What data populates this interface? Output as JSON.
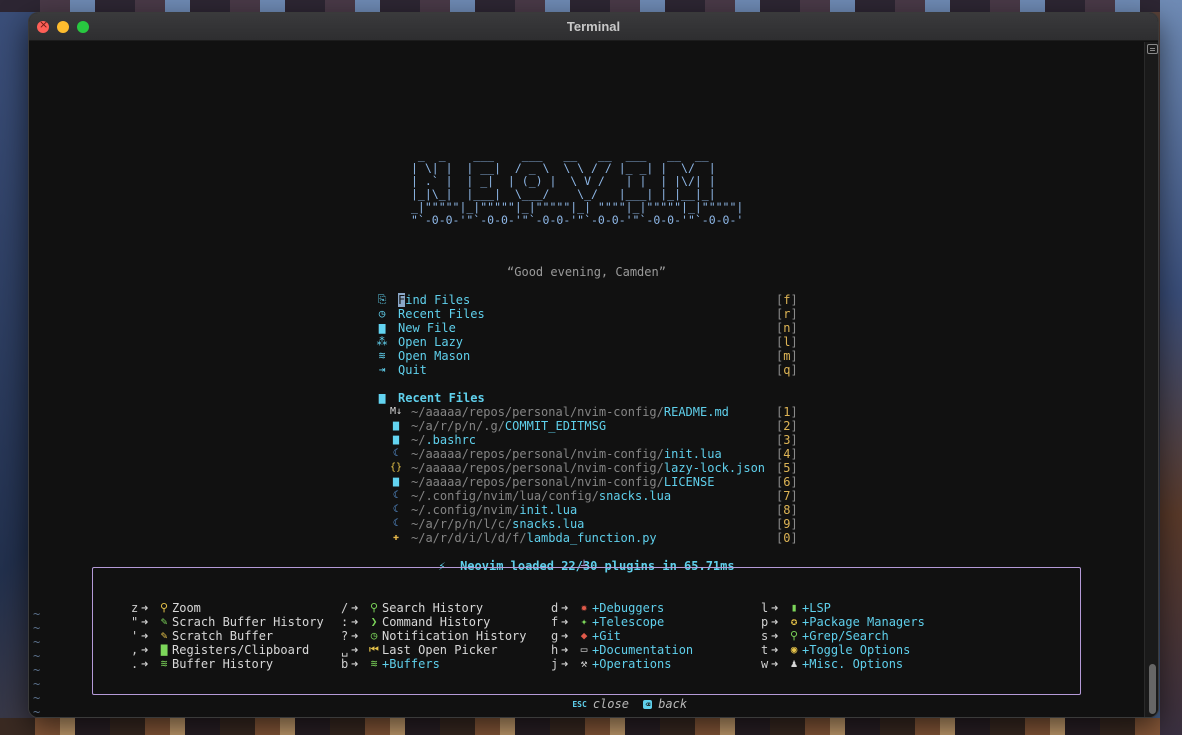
{
  "window": {
    "title": "Terminal"
  },
  "logo": " _  _    ___    ___   __   __  ___   __  __ \n| \\| |  | __|  / _ \\  \\ \\ / / |_ _| |  \\/  |\n| .` |  | _|  | (_) |  \\ V /   | |  | |\\/| |\n|_|\\_|  |___|  \\___/    \\_/   |___| |_|__|_|\n_|\"\"\"\"\"|_|\"\"\"\"\"|_|\"\"\"\"\"|_| \"\"\"\"|_|\"\"\"\"\"|_|\"\"\"\"\"| \n\"`-0-0-'\"`-0-0-'\"`-0-0-'\"`-0-0-'\"`-0-0-'\"`-0-0-'",
  "greeting": "“Good evening, Camden”",
  "menu": [
    {
      "icon": "⎘",
      "icon_name": "find-files-icon",
      "label_first": "F",
      "label_rest": "ind Files",
      "key": "f"
    },
    {
      "icon": "◷",
      "icon_name": "history-icon",
      "label": "Recent Files",
      "key": "r"
    },
    {
      "icon": "▆",
      "icon_name": "new-file-icon",
      "label": "New File",
      "key": "n"
    },
    {
      "icon": "⁂",
      "icon_name": "sleep-icon",
      "label": "Open Lazy",
      "key": "l"
    },
    {
      "icon": "≋",
      "icon_name": "mason-icon",
      "label": "Open Mason",
      "key": "m"
    },
    {
      "icon": "⇥",
      "icon_name": "quit-icon",
      "label": "Quit",
      "key": "q"
    }
  ],
  "recent_section": {
    "icon": "▆",
    "label": "Recent Files"
  },
  "recent_files": [
    {
      "icon": "M↓",
      "icon_name": "markdown-icon",
      "icon_color": "#d8d8d8",
      "dir": "~/aaaaa/repos/personal/nvim-config/",
      "name": "README.md",
      "key": "1"
    },
    {
      "icon": "▆",
      "icon_name": "file-icon",
      "icon_color": "#62d3f0",
      "dir": "~/a/r/p/n/.g/",
      "name": "COMMIT_EDITMSG",
      "key": "2"
    },
    {
      "icon": "▆",
      "icon_name": "file-icon",
      "icon_color": "#62d3f0",
      "dir": "~/",
      "name": ".bashrc",
      "key": "3"
    },
    {
      "icon": "☾",
      "icon_name": "lua-icon",
      "icon_color": "#62a5f0",
      "dir": "~/aaaaa/repos/personal/nvim-config/",
      "name": "init.lua",
      "key": "4"
    },
    {
      "icon": "{}",
      "icon_name": "json-icon",
      "icon_color": "#e6c34a",
      "dir": "~/aaaaa/repos/personal/nvim-config/",
      "name": "lazy-lock.json",
      "key": "5"
    },
    {
      "icon": "▆",
      "icon_name": "file-icon",
      "icon_color": "#62d3f0",
      "dir": "~/aaaaa/repos/personal/nvim-config/",
      "name": "LICENSE",
      "key": "6"
    },
    {
      "icon": "☾",
      "icon_name": "lua-icon",
      "icon_color": "#62a5f0",
      "dir": "~/.config/nvim/lua/config/",
      "name": "snacks.lua",
      "key": "7"
    },
    {
      "icon": "☾",
      "icon_name": "lua-icon",
      "icon_color": "#62a5f0",
      "dir": "~/.config/nvim/",
      "name": "init.lua",
      "key": "8"
    },
    {
      "icon": "☾",
      "icon_name": "lua-icon",
      "icon_color": "#62a5f0",
      "dir": "~/a/r/p/n/l/c/",
      "name": "snacks.lua",
      "key": "9"
    },
    {
      "icon": "✚",
      "icon_name": "python-icon",
      "icon_color": "#e6b84a",
      "dir": "~/a/r/d/i/l/d/f/",
      "name": "lambda_function.py",
      "key": "0"
    }
  ],
  "startup": "⚡  Neovim loaded 22/30 plugins in 65.71ms",
  "which_key": {
    "col1": [
      {
        "k": "z",
        "icon": "⚲",
        "icon_name": "zoom-icon",
        "icon_color": "#e6c34a",
        "desc": "Zoom",
        "group": false
      },
      {
        "k": "\"",
        "icon": "✎",
        "icon_name": "pencil-icon",
        "icon_color": "#7cd65a",
        "desc": "Scrach Buffer History",
        "group": false
      },
      {
        "k": "'",
        "icon": "✎",
        "icon_name": "pencil-icon",
        "icon_color": "#e6c34a",
        "desc": "Scratch Buffer",
        "group": false
      },
      {
        "k": ",",
        "icon": "▇",
        "icon_name": "clipboard-icon",
        "icon_color": "#7cd65a",
        "desc": "Registers/Clipboard",
        "group": false
      },
      {
        "k": ".",
        "icon": "≋",
        "icon_name": "layers-icon",
        "icon_color": "#7cd65a",
        "desc": "Buffer History",
        "group": false
      }
    ],
    "col2": [
      {
        "k": "/",
        "icon": "⚲",
        "icon_name": "search-icon",
        "icon_color": "#7cd65a",
        "desc": "Search History",
        "group": false
      },
      {
        "k": ":",
        "icon": "❯",
        "icon_name": "terminal-icon",
        "icon_color": "#7cd65a",
        "desc": "Command History",
        "group": false
      },
      {
        "k": "?",
        "icon": "◷",
        "icon_name": "history-icon",
        "icon_color": "#7cd65a",
        "desc": "Notification History",
        "group": false
      },
      {
        "k": "␣",
        "icon": "⏮",
        "icon_name": "previous-icon",
        "icon_color": "#e6c34a",
        "desc": "Last Open Picker",
        "group": false
      },
      {
        "k": "b",
        "icon": "≋",
        "icon_name": "layers-icon",
        "icon_color": "#7cd65a",
        "desc": "+Buffers",
        "group": true
      }
    ],
    "col3": [
      {
        "k": "d",
        "icon": "✹",
        "icon_name": "bug-icon",
        "icon_color": "#e05a4a",
        "desc": "+Debuggers",
        "group": true
      },
      {
        "k": "f",
        "icon": "✦",
        "icon_name": "telescope-icon",
        "icon_color": "#7cd65a",
        "desc": "+Telescope",
        "group": true
      },
      {
        "k": "g",
        "icon": "◆",
        "icon_name": "git-icon",
        "icon_color": "#e05a4a",
        "desc": "+Git",
        "group": true
      },
      {
        "k": "h",
        "icon": "▭",
        "icon_name": "docs-icon",
        "icon_color": "#d8d8d8",
        "desc": "+Documentation",
        "group": true
      },
      {
        "k": "j",
        "icon": "⚒",
        "icon_name": "operations-icon",
        "icon_color": "#d8d8d8",
        "desc": "+Operations",
        "group": true
      }
    ],
    "col4": [
      {
        "k": "l",
        "icon": "▮",
        "icon_name": "lsp-icon",
        "icon_color": "#7cd65a",
        "desc": "+LSP",
        "group": true
      },
      {
        "k": "p",
        "icon": "✪",
        "icon_name": "package-icon",
        "icon_color": "#e6c34a",
        "desc": "+Package Managers",
        "group": true
      },
      {
        "k": "s",
        "icon": "⚲",
        "icon_name": "search-icon",
        "icon_color": "#7cd65a",
        "desc": "+Grep/Search",
        "group": true
      },
      {
        "k": "t",
        "icon": "◉",
        "icon_name": "toggle-icon",
        "icon_color": "#e6c34a",
        "desc": "+Toggle Options",
        "group": true
      },
      {
        "k": "w",
        "icon": "♟",
        "icon_name": "misc-icon",
        "icon_color": "#d8d8d8",
        "desc": "+Misc. Options",
        "group": true
      }
    ],
    "arrow": "➜",
    "close_badge": "ESC",
    "close_label": "close",
    "back_badge": "⌫",
    "back_label": "back"
  },
  "tilde": "~"
}
